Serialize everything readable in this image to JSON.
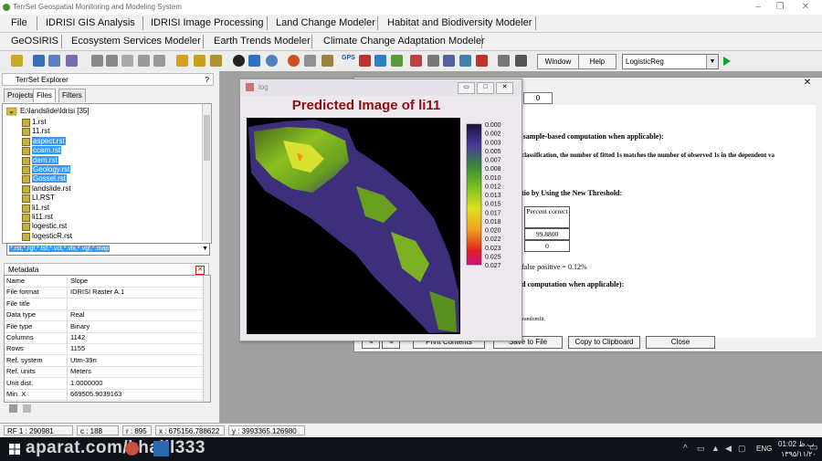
{
  "app": {
    "title": "TerrSet Geospatial Monitoring and Modeling System"
  },
  "menu": {
    "row1": [
      "File",
      "IDRISI  GIS Analysis",
      "IDRISI  Image Processing",
      "Land Change Modeler",
      "Habitat and Biodiversity Modeler"
    ],
    "row2": [
      "GeOSIRIS",
      "Ecosystem Services Modeler",
      "Earth Trends Modeler",
      "Climate Change Adaptation Modeler"
    ]
  },
  "toolbar": {
    "window_label": "Window",
    "help_label": "Help",
    "module_value": "LogisticReg",
    "gps_label": "GPS"
  },
  "explorer": {
    "title": "TerrSet Explorer",
    "help": "?",
    "tabs": [
      "Projects",
      "Files",
      "Filters"
    ],
    "folder": "E:\\landslide\\ldrisi [35]",
    "files": [
      {
        "name": "1.rst",
        "selected": false
      },
      {
        "name": "11.rst",
        "selected": false
      },
      {
        "name": "aspect.rst",
        "selected": true
      },
      {
        "name": "ccam.rst",
        "selected": true
      },
      {
        "name": "dem.rst",
        "selected": true
      },
      {
        "name": "Geology.rst",
        "selected": true
      },
      {
        "name": "Gossel.rst",
        "selected": true
      },
      {
        "name": "landslide.rst",
        "selected": false
      },
      {
        "name": "LI.RST",
        "selected": false
      },
      {
        "name": "li1.rst",
        "selected": false
      },
      {
        "name": "li11.rst",
        "selected": false
      },
      {
        "name": "logestic.rst",
        "selected": false
      },
      {
        "name": "logesticR.rst",
        "selected": false
      }
    ],
    "filter": "*.rst,*.rgf,*.tsf,*.vct,*.vlx,*.vgf,*.map",
    "metadata_title": "Metadata",
    "metadata": [
      {
        "k": "Name",
        "v": "Slope"
      },
      {
        "k": "File format",
        "v": "IDRISI Raster A.1"
      },
      {
        "k": "File title",
        "v": ""
      },
      {
        "k": "Data type",
        "v": "Real"
      },
      {
        "k": "File type",
        "v": "Binary"
      },
      {
        "k": "Columns",
        "v": "1142"
      },
      {
        "k": "Rows",
        "v": "1155"
      },
      {
        "k": "Ref. system",
        "v": "Utm-39n"
      },
      {
        "k": "Ref. units",
        "v": "Meters"
      },
      {
        "k": "Unit dist.",
        "v": "1.0000000"
      },
      {
        "k": "Min. X",
        "v": "669505.9039163"
      }
    ]
  },
  "logistic_dialog": {
    "top_value": "0",
    "heading1": "(sample-based computation when applicable):",
    "line1": "classification, the number of fitted 1s matches the number of observed 1s in the dependent va",
    "heading2": "tio by Using the New Threshold:",
    "table_header": "Percent correct",
    "table_values": [
      "99.8800",
      "0"
    ],
    "fp_text": "false positive = 0.12%",
    "heading3": "d computation when applicable):",
    "small_text": "randomfit.",
    "buttons": [
      "Print Contents",
      "Save to File",
      "Copy to Clipboard",
      "Close"
    ]
  },
  "image_window": {
    "title": "log",
    "map_title": "Predicted Image of li11",
    "legend_values": [
      "0.000",
      "0.002",
      "0.003",
      "0.005",
      "0.007",
      "0.008",
      "0.010",
      "0.012",
      "0.013",
      "0.015",
      "0.017",
      "0.018",
      "0.020",
      "0.022",
      "0.023",
      "0.025",
      "0.027"
    ]
  },
  "status": {
    "rf": "RF 1 : 290981",
    "c": "c : 188",
    "r": "r : 895",
    "x": "x : 675156.788622",
    "y": "y : 3993365.126980"
  },
  "taskbar": {
    "watermark": "aparat.com/khalil333",
    "lang": "ENG",
    "time": "01:02 ب.ظ",
    "date": "۱۳۹۵/۱۱/۲۰"
  },
  "colors": {
    "accent": "#3399ff",
    "title_red": "#8b1010",
    "taskbar": "#10131a"
  }
}
